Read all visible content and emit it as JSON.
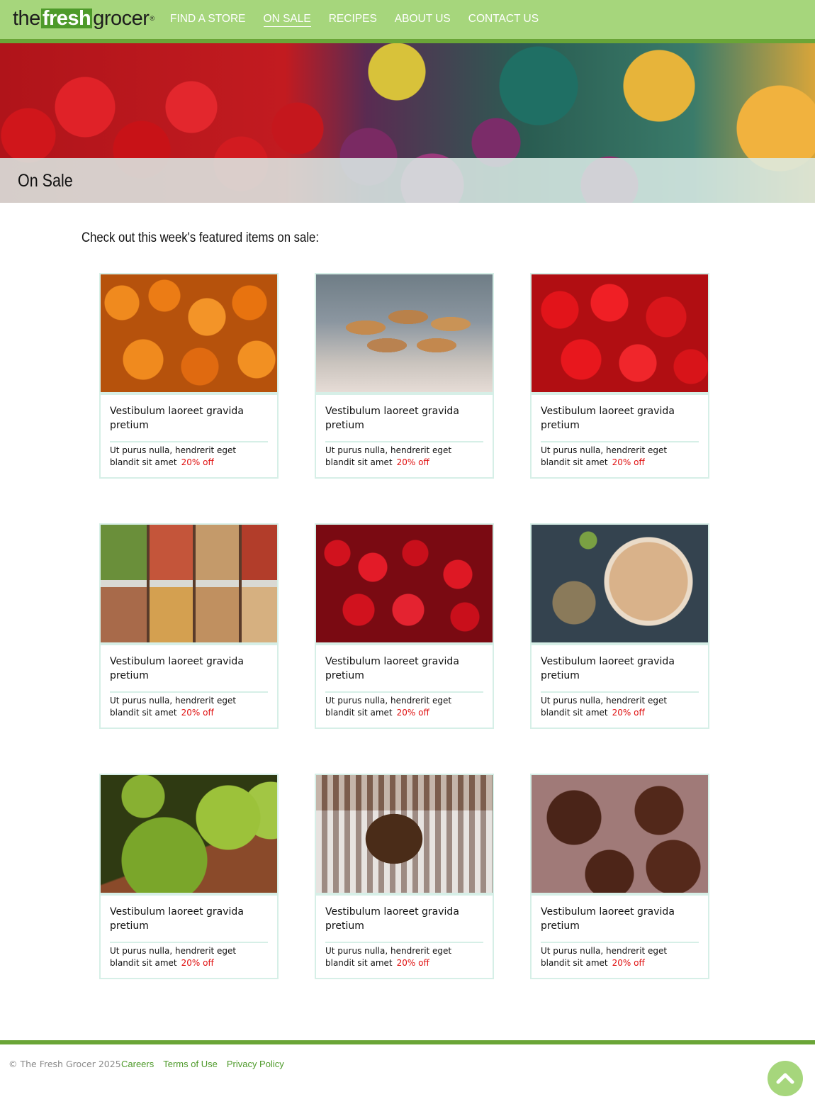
{
  "brand": {
    "logo_prefix": "the",
    "logo_highlight": "fresh",
    "logo_suffix": "grocer",
    "registered": "®",
    "accent": "#a6d67c",
    "accent_dark": "#6aa537",
    "sale_color": "#e01010"
  },
  "nav": {
    "items": [
      {
        "label": "FIND A STORE"
      },
      {
        "label": "ON SALE",
        "active": true
      },
      {
        "label": "RECIPES"
      },
      {
        "label": "ABOUT US"
      },
      {
        "label": "CONTACT US"
      }
    ]
  },
  "hero": {
    "title": "On Sale",
    "image": "produce-banner"
  },
  "intro": "Check out this week's featured items on sale:",
  "products": [
    {
      "image": "pumpkins",
      "title": "Vestibulum laoreet gravida pretium",
      "desc": "Ut purus nulla, hendrerit eget blandit sit amet",
      "discount": "20% off"
    },
    {
      "image": "croissants",
      "title": "Vestibulum laoreet gravida pretium",
      "desc": "Ut purus nulla, hendrerit eget blandit sit amet",
      "discount": "20% off"
    },
    {
      "image": "tomatoes",
      "title": "Vestibulum laoreet gravida pretium",
      "desc": "Ut purus nulla, hendrerit eget blandit sit amet",
      "discount": "20% off"
    },
    {
      "image": "market",
      "title": "Vestibulum laoreet gravida pretium",
      "desc": "Ut purus nulla, hendrerit eget blandit sit amet",
      "discount": "20% off"
    },
    {
      "image": "strawberries",
      "title": "Vestibulum laoreet gravida pretium",
      "desc": "Ut purus nulla, hendrerit eget blandit sit amet",
      "discount": "20% off"
    },
    {
      "image": "pie",
      "title": "Vestibulum laoreet gravida pretium",
      "desc": "Ut purus nulla, hendrerit eget blandit sit amet",
      "discount": "20% off"
    },
    {
      "image": "apples",
      "title": "Vestibulum laoreet gravida pretium",
      "desc": "Ut purus nulla, hendrerit eget blandit sit amet",
      "discount": "20% off"
    },
    {
      "image": "coffee",
      "title": "Vestibulum laoreet gravida pretium",
      "desc": "Ut purus nulla, hendrerit eget blandit sit amet",
      "discount": "20% off"
    },
    {
      "image": "cupcakes",
      "title": "Vestibulum laoreet gravida pretium",
      "desc": "Ut purus nulla, hendrerit eget blandit sit amet",
      "discount": "20% off"
    }
  ],
  "footer": {
    "copyright": "© The Fresh Grocer 2025",
    "links": [
      {
        "label": "Careers"
      },
      {
        "label": "Terms of Use"
      },
      {
        "label": "Privacy Policy"
      }
    ],
    "to_top_icon": "chevron-up-icon"
  }
}
